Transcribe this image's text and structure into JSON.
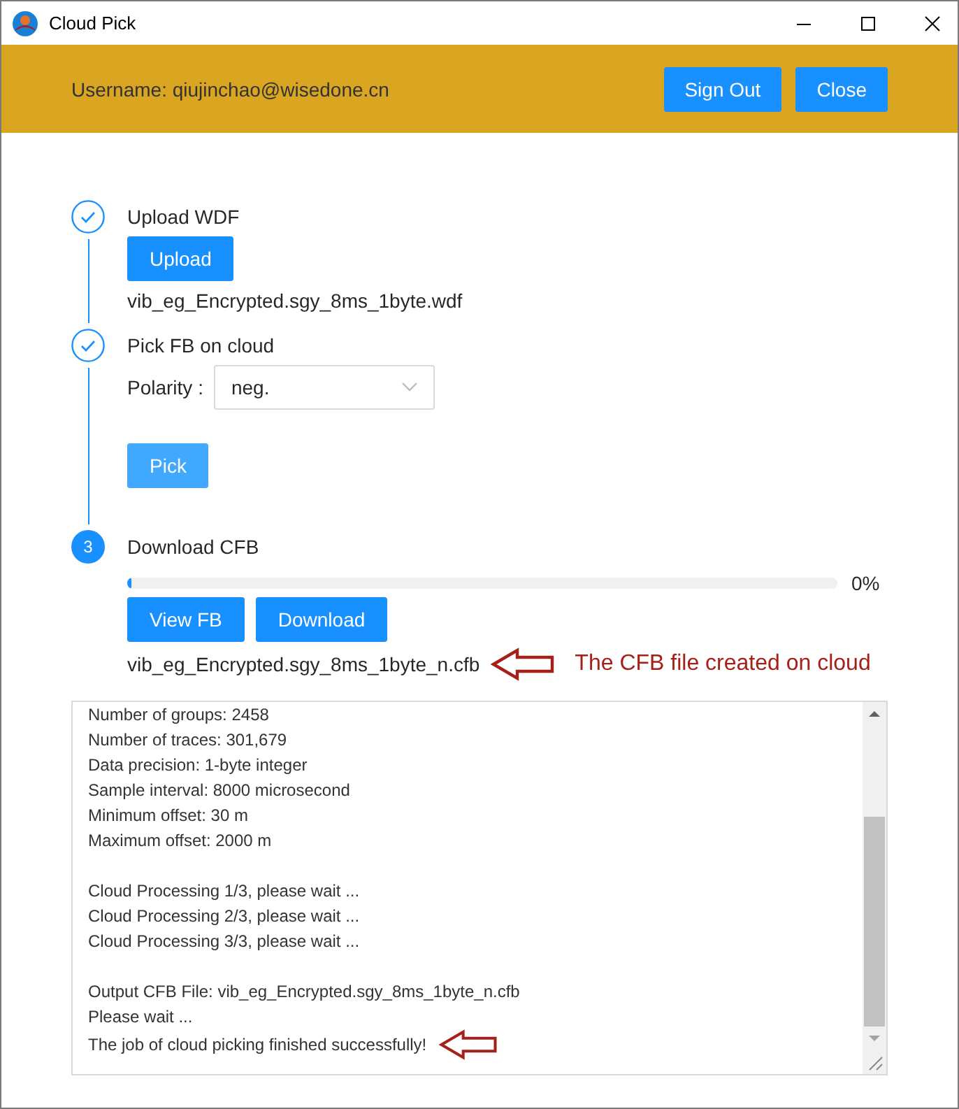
{
  "window": {
    "title": "Cloud Pick"
  },
  "header": {
    "username": "Username: qiujinchao@wisedone.cn",
    "buttons": [
      {
        "label": "Sign Out"
      },
      {
        "label": "Close"
      }
    ]
  },
  "steps": [
    {
      "title": "Upload WDF",
      "done": true,
      "kind": "upload",
      "button": {
        "label": "Upload",
        "hovered": false
      },
      "file": "vib_eg_Encrypted.sgy_8ms_1byte.wdf"
    },
    {
      "title": "Pick FB on cloud",
      "done": true,
      "kind": "pick",
      "field_label": "Polarity :",
      "polarity": "neg.",
      "button": {
        "label": "Pick",
        "hovered": true
      }
    },
    {
      "title": "Download CFB",
      "done": false,
      "number": "3",
      "kind": "download",
      "progress": {
        "level": 0,
        "reading": "0%"
      },
      "buttons": [
        {
          "label": "View FB",
          "hovered": false
        },
        {
          "label": "Download",
          "hovered": false
        }
      ],
      "file": "vib_eg_Encrypted.sgy_8ms_1byte_n.cfb",
      "note": "The CFB file created on cloud"
    }
  ],
  "log": {
    "lines": [
      {
        "text": "Number of groups: 2458",
        "arrow": false
      },
      {
        "text": "Number of traces: 301,679",
        "arrow": false
      },
      {
        "text": "Data precision: 1-byte integer",
        "arrow": false
      },
      {
        "text": "Sample interval: 8000 microsecond",
        "arrow": false
      },
      {
        "text": "Minimum offset: 30 m",
        "arrow": false
      },
      {
        "text": "Maximum offset: 2000 m",
        "arrow": false
      },
      {
        "text": "Cloud Processing 1/3, please wait ...",
        "arrow": false,
        "gap_before": true
      },
      {
        "text": "Cloud Processing 2/3, please wait ...",
        "arrow": false
      },
      {
        "text": "Cloud Processing 3/3, please wait ...",
        "arrow": false
      },
      {
        "text": "Output CFB File: vib_eg_Encrypted.sgy_8ms_1byte_n.cfb",
        "arrow": false,
        "gap_before": true
      },
      {
        "text": "Please wait ...",
        "arrow": false
      },
      {
        "text": "The job of cloud picking finished successfully!",
        "arrow": true
      }
    ]
  }
}
